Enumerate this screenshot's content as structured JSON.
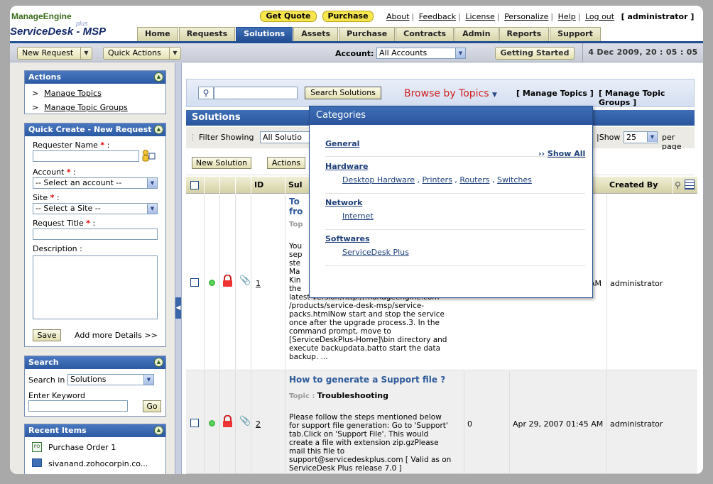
{
  "header": {
    "logo_top": "ManageEngine",
    "logo_plus": "plus",
    "logo_bottom": "ServiceDesk - MSP",
    "get_quote": "Get Quote",
    "purchase_btn": "Purchase",
    "links": [
      "About",
      "Feedback",
      "License",
      "Personalize",
      "Help"
    ],
    "logout": "Log out",
    "user": "[ administrator ]"
  },
  "tabs": [
    "Home",
    "Requests",
    "Solutions",
    "Assets",
    "Purchase",
    "Contracts",
    "Admin",
    "Reports",
    "Support"
  ],
  "active_tab": "Solutions",
  "navbar": {
    "new_request": "New Request",
    "quick_actions": "Quick Actions",
    "account_label": "Account:",
    "account_value": "All Accounts",
    "getting_started": "Getting Started",
    "datetime": "4 Dec 2009, 20 : 05 : 05"
  },
  "actions_panel": {
    "title": "Actions",
    "items": [
      "Manage Topics",
      "Manage Topic Groups"
    ]
  },
  "quick_create": {
    "title": "Quick Create - New Request",
    "requester_label": "Requester Name",
    "account_label": "Account",
    "account_select": "-- Select an account --",
    "site_label": "Site",
    "site_select": "-- Select a Site --",
    "title_label": "Request Title",
    "desc_label": "Description :",
    "save": "Save",
    "more": "Add more Details >>"
  },
  "search_panel": {
    "title": "Search",
    "search_in": "Search in :",
    "search_in_value": "Solutions",
    "keyword_label": "Enter Keyword",
    "go": "Go"
  },
  "recent_panel": {
    "title": "Recent Items",
    "items": [
      "Purchase Order 1",
      "sivanand.zohocorpin.co..."
    ]
  },
  "main": {
    "search_button": "Search Solutions",
    "browse_topics": "Browse by Topics",
    "manage_topics": "[ Manage Topics ]",
    "manage_topic_groups": "[ Manage Topic Groups ]",
    "section_title": "Solutions",
    "filter_label": "Filter Showing",
    "filter_value": "All Solutio",
    "show_label": "|Show",
    "per_page_value": "25",
    "per_page": "per page",
    "new_solution": "New Solution",
    "actions": "Actions",
    "columns": {
      "id": "ID",
      "subject": "Sul",
      "created_by": "Created By"
    }
  },
  "rows": [
    {
      "id": "1",
      "title_lines": [
        "To",
        "fro"
      ],
      "topic_label": "Top",
      "desc_lines": [
        "You",
        "sep",
        "ste",
        "Ma",
        "Kin",
        "the",
        "latest version;http://manageengine.com",
        "/products/service-desk-msp/service-",
        "packs.htmlNow start and stop the service",
        "once after the upgrade process.3. In the",
        "command prompt, move to",
        "[ServiceDeskPlus-Home]\\bin directory and",
        "execute backupdata.batto start the data",
        "backup. ..."
      ],
      "viewed": "",
      "date": "AM",
      "created_by": "administrator"
    },
    {
      "id": "2",
      "title": "How to generate a Support file ?",
      "topic_label": "Topic :",
      "topic": "Troubleshooting",
      "desc_lines": [
        "Please follow the steps mentioned below",
        "for support file generation: Go to 'Support'",
        "tab.Click on 'Support File'. This would",
        "create a file with extension zip.gzPlease",
        "mail this file to",
        "support@servicedeskplus.com [ Valid as on",
        "ServiceDesk Plus release 7.0 ]"
      ],
      "viewed": "0",
      "date": "Apr 29, 2007 01:45 AM",
      "created_by": "administrator"
    }
  ],
  "popup": {
    "title": "Categories",
    "show_all": "Show All",
    "categories": [
      {
        "name": "General",
        "items": []
      },
      {
        "name": "Hardware",
        "items": [
          "Desktop Hardware",
          "Printers",
          "Routers",
          "Switches"
        ]
      },
      {
        "name": "Network",
        "items": [
          "Internet"
        ]
      },
      {
        "name": "Softwares",
        "items": [
          "ServiceDesk Plus"
        ]
      }
    ]
  },
  "colors": {
    "accent": "#2a559c",
    "tab_active": "#234f94",
    "browse": "#d1211f",
    "yellow_btn": "#f7e54e"
  }
}
